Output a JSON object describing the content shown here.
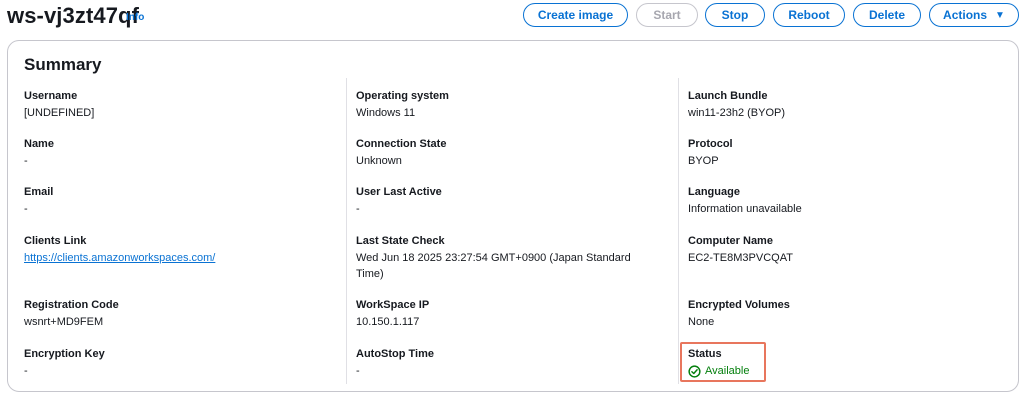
{
  "header": {
    "title": "ws-vj3zt47qf",
    "info_label": "Info",
    "buttons": {
      "create_image": "Create image",
      "start": "Start",
      "stop": "Stop",
      "reboot": "Reboot",
      "delete": "Delete",
      "actions": "Actions"
    }
  },
  "summary": {
    "title": "Summary",
    "col1": [
      {
        "label": "Username",
        "value": "[UNDEFINED]"
      },
      {
        "label": "Name",
        "value": "-"
      },
      {
        "label": "Email",
        "value": "-"
      },
      {
        "label": "Clients Link",
        "value": "https://clients.amazonworkspaces.com/"
      },
      {
        "label": "Registration Code",
        "value": "wsnrt+MD9FEM"
      },
      {
        "label": "Encryption Key",
        "value": "-"
      }
    ],
    "col2": [
      {
        "label": "Operating system",
        "value": "Windows 11"
      },
      {
        "label": "Connection State",
        "value": "Unknown"
      },
      {
        "label": "User Last Active",
        "value": "-"
      },
      {
        "label": "Last State Check",
        "value": "Wed Jun 18 2025 23:27:54 GMT+0900 (Japan Standard Time)"
      },
      {
        "label": "WorkSpace IP",
        "value": "10.150.1.117"
      },
      {
        "label": "AutoStop Time",
        "value": "-"
      }
    ],
    "col3": [
      {
        "label": "Launch Bundle",
        "value": "win11-23h2 (BYOP)"
      },
      {
        "label": "Protocol",
        "value": "BYOP"
      },
      {
        "label": "Language",
        "value": "Information unavailable"
      },
      {
        "label": "Computer Name",
        "value": "EC2-TE8M3PVCQAT"
      },
      {
        "label": "Encrypted Volumes",
        "value": "None"
      },
      {
        "label": "Status",
        "value": "Available"
      }
    ]
  },
  "colors": {
    "link": "#0972d3",
    "success": "#037f0c",
    "highlight": "#e8765d",
    "border": "#c6c6cd"
  },
  "icons": {
    "status": "check-circle-icon",
    "actions_caret": "caret-down-icon"
  }
}
